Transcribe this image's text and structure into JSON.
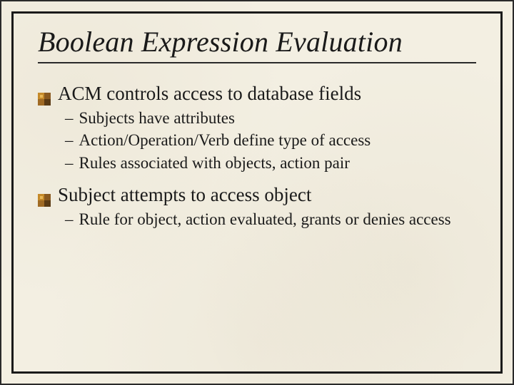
{
  "slide": {
    "title": "Boolean Expression Evaluation",
    "bullets": [
      {
        "text": "ACM controls access to database fields",
        "sub": [
          "Subjects have attributes",
          "Action/Operation/Verb define type of access",
          "Rules associated with objects, action pair"
        ]
      },
      {
        "text": "Subject attempts to access object",
        "sub": [
          "Rule for object, action evaluated, grants or denies access"
        ]
      }
    ]
  },
  "glyphs": {
    "dash": "–"
  }
}
